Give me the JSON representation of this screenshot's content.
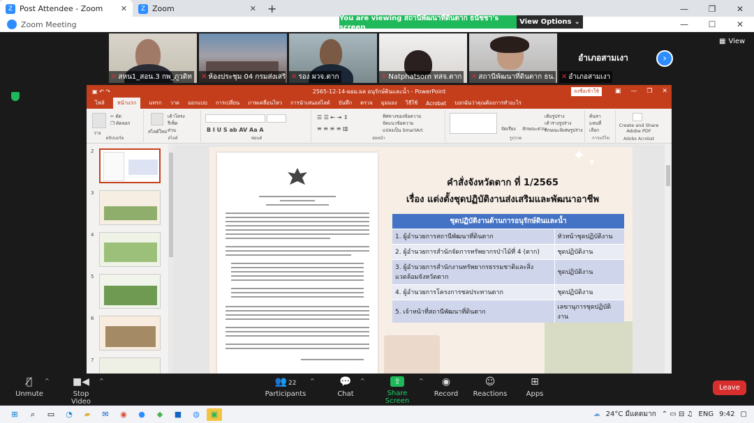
{
  "browser": {
    "tab_active": "Post Attendee - Zoom",
    "tab_inactive": "Zoom",
    "new_tab": "+"
  },
  "zoom": {
    "window_title": "Zoom Meeting",
    "viewing_banner": "You are viewing สถานีพัฒนาที่ดินตาก ธนัชชา's screen",
    "view_options": "View Options",
    "view_label": "View"
  },
  "participants": [
    {
      "name": "สหน1_สอน.3 กพ_ภูวดิท"
    },
    {
      "name": "ห้องประชุม 04 กรมส่งเสริ..."
    },
    {
      "name": "รอง ผวจ.ตาก"
    },
    {
      "name": "Natphatsorn ทสจ.ตาก"
    },
    {
      "name": "สถานีพัฒนาที่ดินตาก ธน..."
    },
    {
      "name": "อำเภอสามเงา",
      "big": "อำเภอสามเงา"
    }
  ],
  "ppt": {
    "filename": "2565-12-14-ผอม.ผล อนุรักษ์ดินและน้ำ - PowerPoint",
    "signin": "ลงชื่อเข้าใช้",
    "tabs": [
      "ไฟล์",
      "หน้าแรก",
      "แทรก",
      "วาด",
      "ออกแบบ",
      "การเปลี่ยน",
      "ภาพเคลื่อนไหว",
      "การนำเสนอสไลด์",
      "บันทึก",
      "ตรวจ",
      "มุมมอง",
      "วิธีใช้",
      "Acrobat",
      "บอกฉันว่าคุณต้องการทำอะไร"
    ],
    "ribbon_groups": [
      "คลิปบอร์ด",
      "สไลด์",
      "ฟอนต์",
      "ย่อหน้า",
      "รูปวาด",
      "การแก้ไข",
      "Adobe Acrobat"
    ],
    "ribbon_labels": {
      "paste": "วาง",
      "new_slide": "สไลด์ใหม่",
      "layout": "เค้าโครง",
      "reset": "รีเซ็ต",
      "section": "ส่วน",
      "text_direction": "ทิศทางของข้อความ",
      "align_text": "จัดแนวข้อความ",
      "smartart": "แปลงเป็น SmartArt",
      "arrange": "จัดเรียง",
      "quick_styles": "ลักษณะด่วน",
      "shape_fill": "เติมรูปร่าง",
      "shape_outline": "เค้าร่างรูปร่าง",
      "shape_effects": "ลักษณะพิเศษรูปร่าง",
      "find": "ค้นหา",
      "replace": "แทนที่",
      "select": "เลือก",
      "create_pdf": "Create and Share Adobe PDF"
    },
    "slide_numbers": [
      "2",
      "3",
      "4",
      "5",
      "6",
      "7"
    ]
  },
  "slide": {
    "title": "คำสั่งจังหวัดตาก ที่ 1/2565",
    "subtitle": "เรื่อง แต่งตั้งชุดปฏิบัติงานส่งเสริมและพัฒนาอาชีพ",
    "table_header": "ชุดปฏิบัติงานด้านการอนุรักษ์ดินและน้ำ",
    "rows": [
      {
        "left": "1. ผู้อำนวยการสถานีพัฒนาที่ดินตาก",
        "right": "หัวหน้าชุดปฏิบัติงาน"
      },
      {
        "left": "2. ผู้อำนวยการสำนักจัดการทรัพยากรป่าไม้ที่ 4 (ตาก)",
        "right": "ชุดปฏิบัติงาน"
      },
      {
        "left": "3. ผู้อำนวยการสำนักงานทรัพยากรธรรมชาติและสิ่งแวดล้อมจังหวัดตาก",
        "right": "ชุดปฏิบัติงาน"
      },
      {
        "left": "4. ผู้อำนวยการโครงการชลประทานตาก",
        "right": "ชุดปฏิบัติงาน"
      },
      {
        "left": "5. เจ้าหน้าที่สถานีพัฒนาที่ดินตาก",
        "right": "เลขานุการชุดปฏิบัติงาน"
      }
    ]
  },
  "toolbar": {
    "unmute": "Unmute",
    "stop_video": "Stop Video",
    "participants": "Participants",
    "participants_count": "22",
    "chat": "Chat",
    "share_screen": "Share Screen",
    "record": "Record",
    "reactions": "Reactions",
    "apps": "Apps",
    "leave": "Leave"
  },
  "taskbar": {
    "weather": "24°C มีแดดมาก",
    "lang": "ENG",
    "time": "9:42"
  },
  "colors": {
    "zoom_green": "#1fb85a",
    "zoom_blue": "#2d8cff",
    "ppt_red": "#c43e1c",
    "table_blue": "#4472c4",
    "leave_red": "#d92e2e"
  }
}
